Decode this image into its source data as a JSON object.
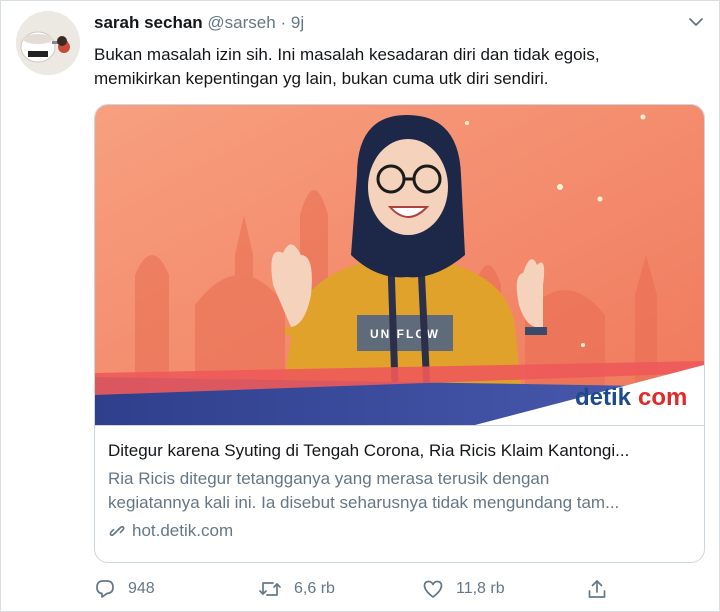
{
  "tweet": {
    "display_name": "sarah sechan",
    "handle": "@sarseh",
    "separator": "·",
    "time": "9j",
    "text_lines": [
      "Bukan masalah izin sih. Ini masalah kesadaran diri dan tidak egois,",
      "memikirkan kepentingan yg lain, bukan cuma utk diri sendiri."
    ]
  },
  "card": {
    "image_brand": "detikcom",
    "title": "Ditegur karena Syuting di Tengah Corona, Ria Ricis Klaim Kantongi...",
    "description_lines": [
      "Ria Ricis ditegur tetangganya yang merasa terusik dengan",
      "kegiatannya kali ini. Ia disebut seharusnya tidak mengundang tam..."
    ],
    "domain": "hot.detik.com"
  },
  "actions": {
    "replies": "948",
    "retweets": "6,6 rb",
    "likes": "11,8 rb"
  },
  "icons": [
    "chevron-down-icon",
    "link-icon",
    "reply-icon",
    "retweet-icon",
    "like-icon",
    "share-icon"
  ],
  "colors": {
    "text_primary": "#14171a",
    "text_secondary": "#657786",
    "border": "#ccd6dd",
    "image_background": "#f58f6d",
    "brand_blue": "#1d4a8c",
    "brand_red": "#e02a2a"
  }
}
